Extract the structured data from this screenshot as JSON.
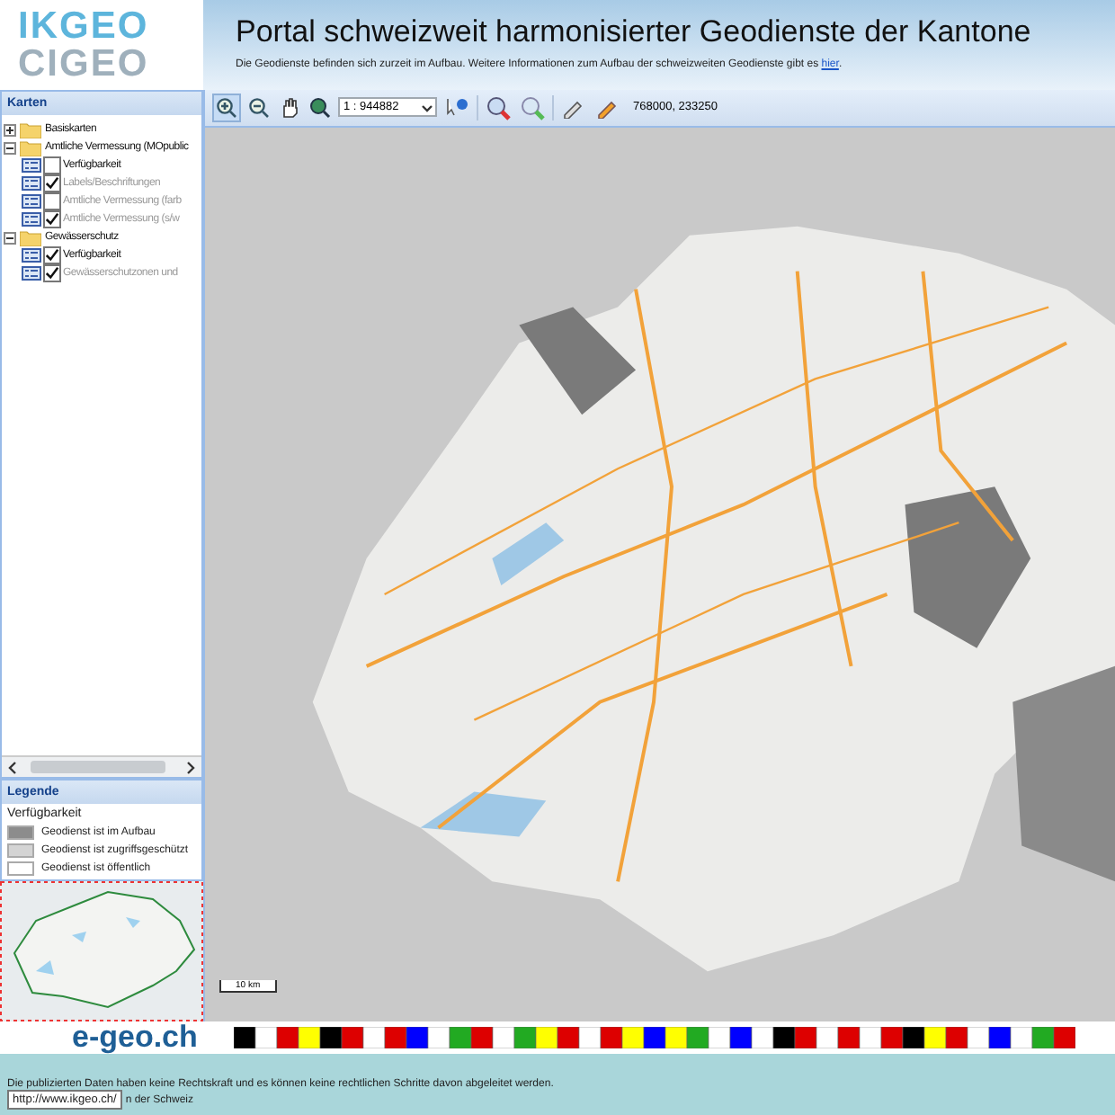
{
  "header": {
    "logo_top": "IKGEO",
    "logo_bottom": "CIGEO",
    "title": "Portal schweizweit harmonisierter Geodienste der Kantone",
    "subtitle": "Die Geodienste befinden sich zurzeit im Aufbau. Weitere Informationen zum Aufbau der schweizweiten Geodienste gibt es",
    "link": "hier",
    "after_link": "."
  },
  "toolbar": {
    "scale": "1 : 944882",
    "coordinates": "768000, 233250"
  },
  "layers_panel": {
    "title": "Karten",
    "groups": [
      {
        "label": "Basiskarten",
        "expanded": false
      },
      {
        "label": "Amtliche Vermessung (MOpublic",
        "expanded": true,
        "children": [
          {
            "label": "Verfügbarkeit",
            "checked": false,
            "dimmed": false
          },
          {
            "label": "Labels/Beschriftungen",
            "checked": true,
            "dimmed": true
          },
          {
            "label": "Amtliche Vermessung (farb",
            "checked": false,
            "dimmed": true
          },
          {
            "label": "Amtliche Vermessung (s/w",
            "checked": true,
            "dimmed": true
          }
        ]
      },
      {
        "label": "Gewässerschutz",
        "expanded": true,
        "children": [
          {
            "label": "Verfügbarkeit",
            "checked": true,
            "dimmed": false
          },
          {
            "label": "Gewässerschutzonen und",
            "checked": true,
            "dimmed": true
          }
        ]
      }
    ]
  },
  "legend": {
    "title": "Legende",
    "heading": "Verfügbarkeit",
    "items": [
      {
        "label": "Geodienst ist im Aufbau",
        "color": "#8c8c8c"
      },
      {
        "label": "Geodienst ist zugriffsgeschützt",
        "color": "#d4d4d4"
      },
      {
        "label": "Geodienst ist öffentlich",
        "color": "#ffffff"
      }
    ]
  },
  "map": {
    "scale_bar": "10 km"
  },
  "footer": {
    "logo": "e-geo.ch",
    "disclaimer": "Die publizierten Daten haben keine Rechtskraft und es können keine rechtlichen Schritte davon abgeleitet werden.",
    "line_2": "n der Schweiz",
    "tooltip": "http://www.ikgeo.ch/"
  }
}
